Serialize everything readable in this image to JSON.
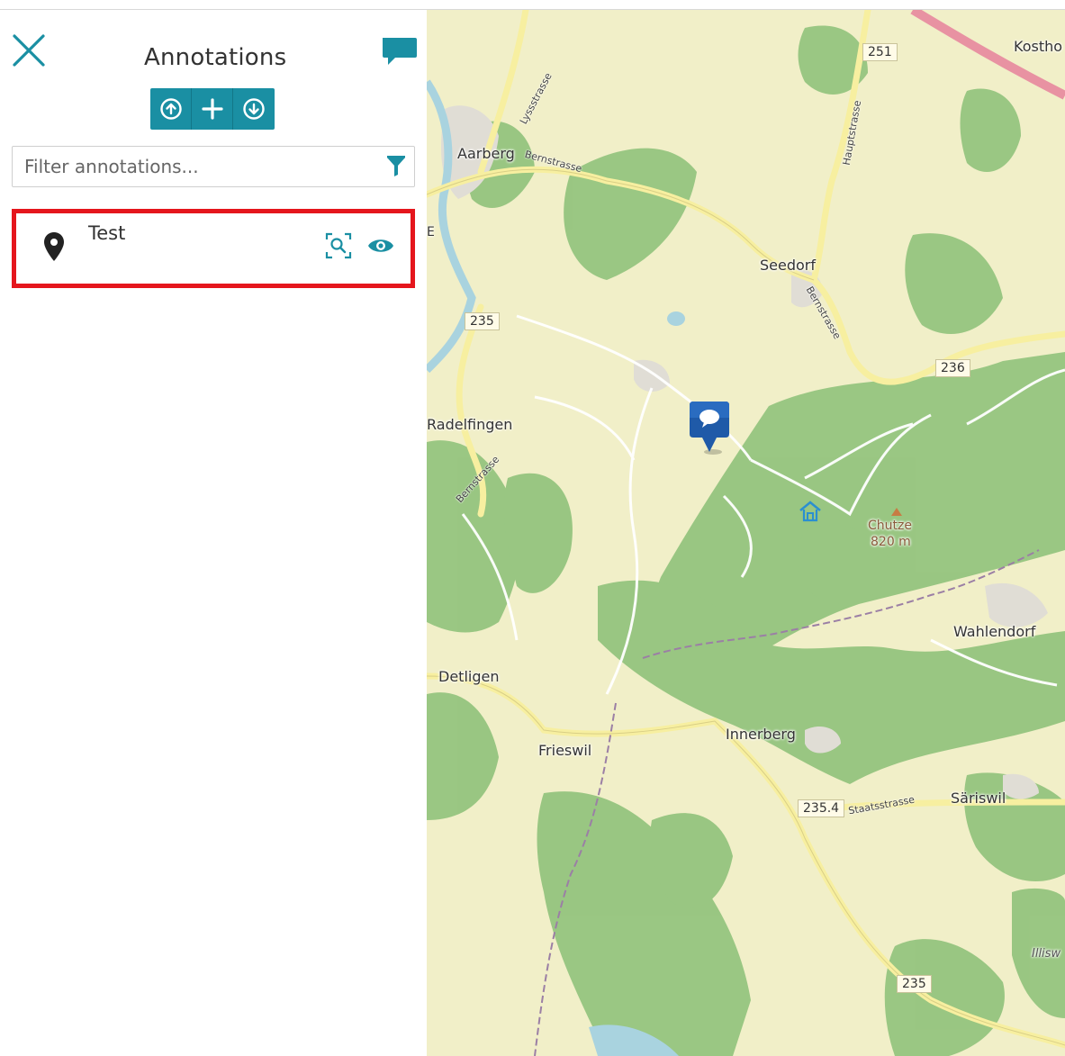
{
  "panel": {
    "title": "Annotations",
    "filter": {
      "placeholder": "Filter annotations..."
    },
    "toolbar": {
      "upload": "upload-icon",
      "add": "plus-icon",
      "download": "download-icon"
    },
    "annotations": [
      {
        "label": "Test",
        "icon": "map-pin-icon"
      }
    ]
  },
  "map": {
    "places": {
      "aarberg": "Aarberg",
      "seedorf": "Seedorf",
      "radelfingen": "Radelfingen",
      "chutze": "Chutze",
      "chutze_elev": "820 m",
      "wahlendorf": "Wahlendorf",
      "detligen": "Detligen",
      "frieswil": "Frieswil",
      "innerberg": "Innerberg",
      "sariswil": "Säriswil",
      "kostho": "Kostho",
      "illisw": "Illisw",
      "e_edge": "E"
    },
    "roads": {
      "r251": "251",
      "r235a": "235",
      "r236": "236",
      "r2354": "235.4",
      "r235b": "235"
    },
    "streets": {
      "lyssstrasse": "Lyssstrasse",
      "bernstrasse1": "Bernstrasse",
      "hauptstrasse": "Hauptstrasse",
      "bernstrasse2": "Bernstrasse",
      "bernstrasse3": "Bernstrasse",
      "staatsstrasse": "Staatsstrasse"
    }
  },
  "colors": {
    "accent": "#1a8fa3",
    "highlight_border": "#e5161d",
    "forest": "#8fc17a",
    "farmland": "#f1efc8",
    "marker": "#1f5aa8"
  }
}
